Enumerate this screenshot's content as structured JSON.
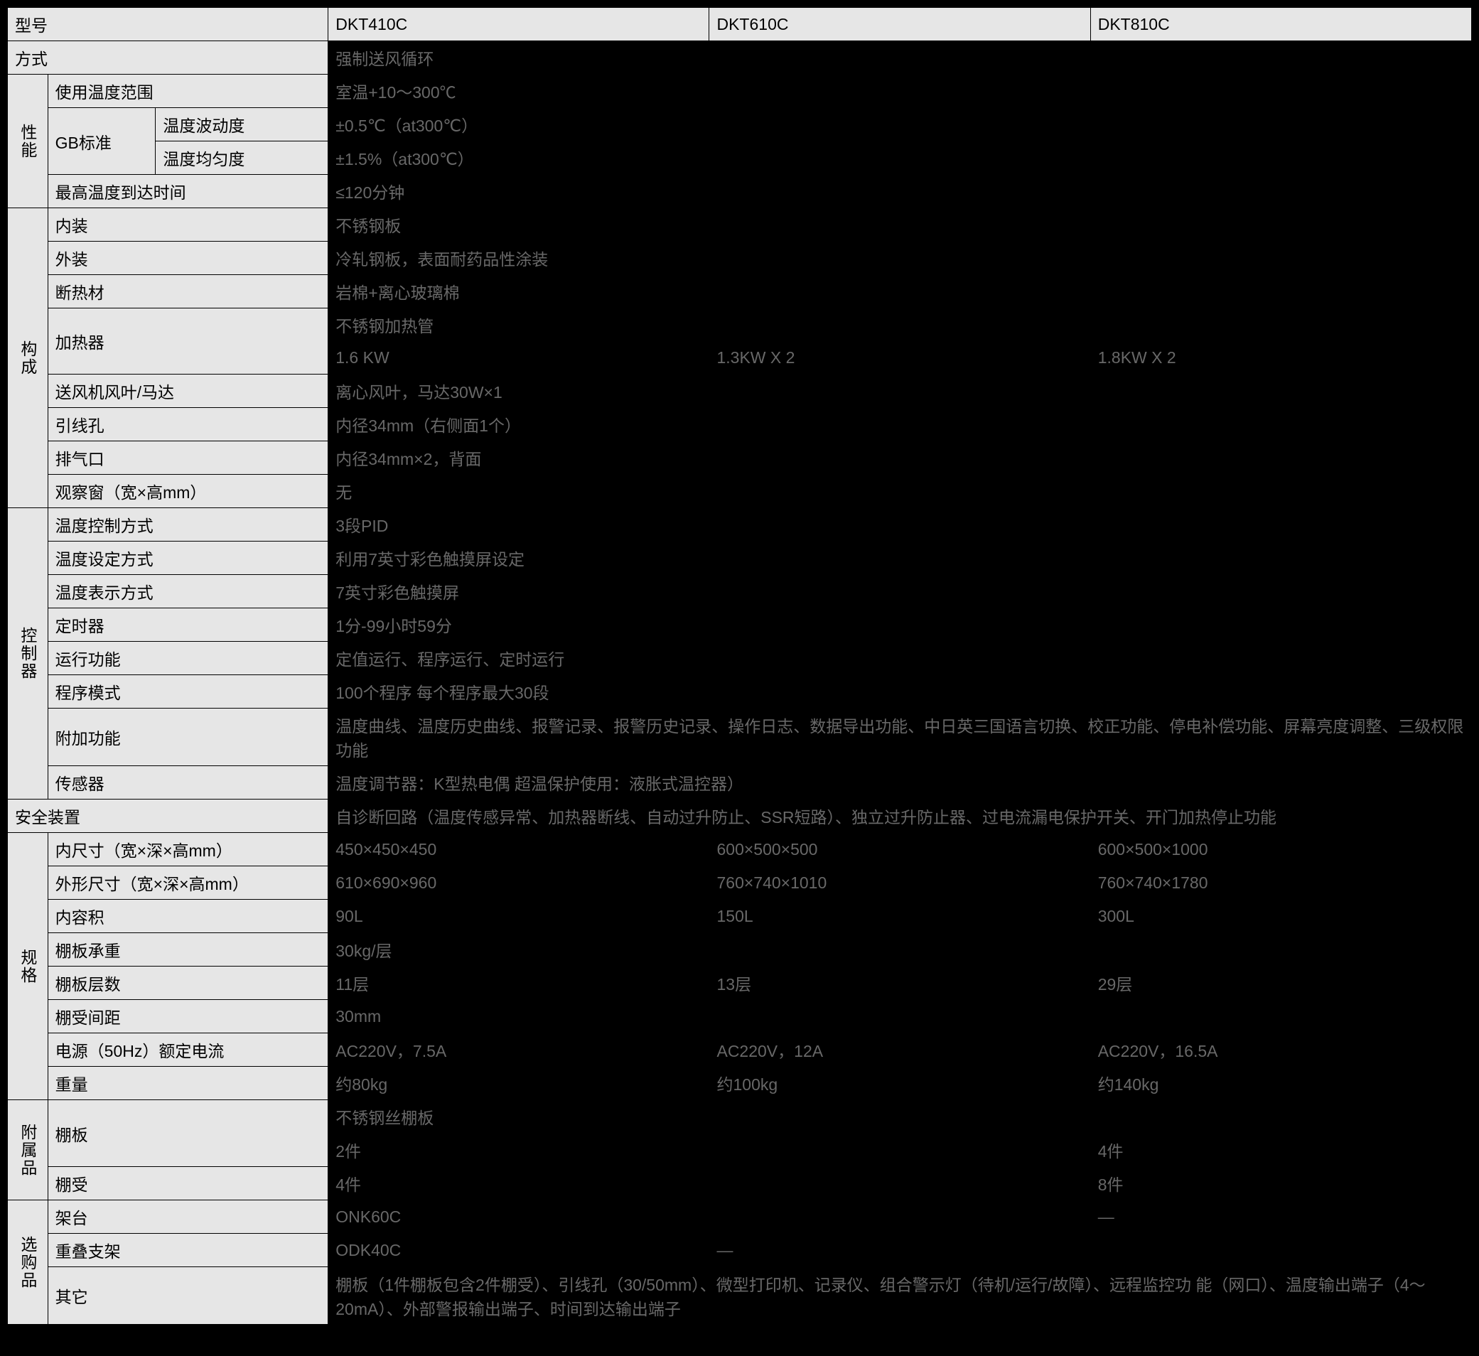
{
  "header": {
    "model": "型号",
    "m1": "DKT410C",
    "m2": "DKT610C",
    "m3": "DKT810C"
  },
  "method": {
    "label": "方式",
    "value": "强制送风循环"
  },
  "perf": {
    "cat": "性能",
    "tempRange": {
      "label": "使用温度范围",
      "value": "室温+10～300℃"
    },
    "gb": "GB标准",
    "fluct": {
      "label": "温度波动度",
      "value": "±0.5℃（at300℃）"
    },
    "unif": {
      "label": "温度均匀度",
      "value": "±1.5%（at300℃）"
    },
    "riseTime": {
      "label": "最高温度到达时间",
      "value": "≤120分钟"
    }
  },
  "struct": {
    "cat": "构成",
    "interior": {
      "label": "内装",
      "value": "不锈钢板"
    },
    "exterior": {
      "label": "外装",
      "value": "冷轧钢板，表面耐药品性涂装"
    },
    "insul": {
      "label": "断热材",
      "value": "岩棉+离心玻璃棉"
    },
    "heater": {
      "label": "加热器",
      "valTop": "不锈钢加热管",
      "v1": "1.6 KW",
      "v2": "1.3KW X 2",
      "v3": "1.8KW X 2"
    },
    "fan": {
      "label": "送风机风叶/马达",
      "value": "离心风叶，马达30W×1"
    },
    "leadHole": {
      "label": "引线孔",
      "value": "内径34mm（右侧面1个）"
    },
    "exhaust": {
      "label": "排气口",
      "value": "内径34mm×2，背面"
    },
    "window": {
      "label": "观察窗（宽×高mm）",
      "value": "无"
    }
  },
  "ctrl": {
    "cat": "控制器",
    "tCtrl": {
      "label": "温度控制方式",
      "value": "3段PID"
    },
    "tSet": {
      "label": "温度设定方式",
      "value": "利用7英寸彩色触摸屏设定"
    },
    "tDisp": {
      "label": "温度表示方式",
      "value": "7英寸彩色触摸屏"
    },
    "timer": {
      "label": "定时器",
      "value": "1分-99小时59分"
    },
    "run": {
      "label": "运行功能",
      "value": "定值运行、程序运行、定时运行"
    },
    "prog": {
      "label": "程序模式",
      "value": "100个程序 每个程序最大30段"
    },
    "add": {
      "label": "附加功能",
      "value": "温度曲线、温度历史曲线、报警记录、报警历史记录、操作日志、数据导出功能、中日英三国语言切换、校正功能、停电补偿功能、屏幕亮度调整、三级权限功能"
    },
    "sensor": {
      "label": "传感器",
      "value": "温度调节器：K型热电偶 超温保护使用：液胀式温控器）"
    }
  },
  "safety": {
    "label": "安全装置",
    "value": "自诊断回路（温度传感异常、加热器断线、自动过升防止、SSR短路）、独立过升防止器、过电流漏电保护开关、开门加热停止功能"
  },
  "spec": {
    "cat": "规格",
    "inner": {
      "label": "内尺寸（宽×深×高mm）",
      "v1": "450×450×450",
      "v2": "600×500×500",
      "v3": "600×500×1000"
    },
    "outer": {
      "label": "外形尺寸（宽×深×高mm）",
      "v1": "610×690×960",
      "v2": "760×740×1010",
      "v3": "760×740×1780"
    },
    "vol": {
      "label": "内容积",
      "v1": "90L",
      "v2": "150L",
      "v3": "300L"
    },
    "shelfLoad": {
      "label": "棚板承重",
      "value": "30kg/层"
    },
    "shelfLayers": {
      "label": "棚板层数",
      "v1": "11层",
      "v2": "13层",
      "v3": "29层"
    },
    "shelfGap": {
      "label": "棚受间距",
      "value": "30mm"
    },
    "power": {
      "label": "电源（50Hz）额定电流",
      "v1": "AC220V，7.5A",
      "v2": "AC220V，12A",
      "v3": "AC220V，16.5A"
    },
    "weight": {
      "label": "重量",
      "v1": "约80kg",
      "v2": "约100kg",
      "v3": "约140kg"
    }
  },
  "acc": {
    "cat": "附属品",
    "shelf": {
      "label": "棚板",
      "top": "不锈钢丝棚板",
      "v1": "2件",
      "v3": "4件"
    },
    "support": {
      "label": "棚受",
      "v1": "4件",
      "v3": "8件"
    }
  },
  "opt": {
    "cat": "选购品",
    "stand": {
      "label": "架台",
      "v1": "ONK60C",
      "v3": "—"
    },
    "stack": {
      "label": "重叠支架",
      "v1": "ODK40C",
      "v2": "—"
    },
    "other": {
      "label": "其它",
      "value": "棚板（1件棚板包含2件棚受）、引线孔（30/50mm）、微型打印机、记录仪、组合警示灯（待机/运行/故障）、远程监控功 能（网口）、温度输出端子（4～20mA）、外部警报输出端子、时间到达输出端子"
    }
  }
}
